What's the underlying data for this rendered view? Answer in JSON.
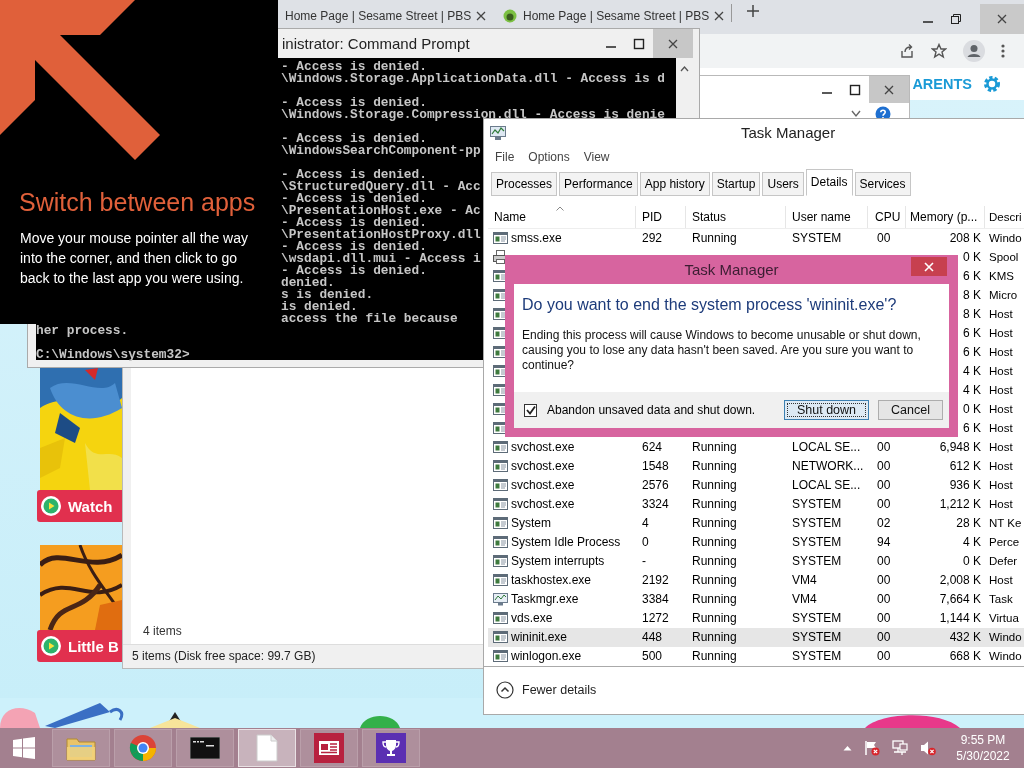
{
  "browser": {
    "tabs": [
      {
        "title": "Home Page | Sesame Street | PBS"
      },
      {
        "title": "Home Page | Sesame Street | PBS"
      }
    ],
    "page": {
      "nav_label": "ARENTS",
      "cards": [
        {
          "button": "Watch"
        },
        {
          "button": "Little B"
        }
      ]
    }
  },
  "explorer": {
    "pane_status": "4 items",
    "status_bar": "5 items (Disk free space: 99.7 GB)"
  },
  "command_prompt": {
    "title": "inistrator: Command Prompt",
    "blocks": [
      [
        "- Access is denied.",
        "\\Windows.Storage.ApplicationData.dll - Access is d"
      ],
      [
        "- Access is denied.",
        "\\Windows.Storage.Compression.dll - Access is denie"
      ],
      [
        "- Access is denied.",
        "\\WindowsSearchComponent-pp"
      ],
      [
        "- Access is denied.",
        "\\StructuredQuery.dll - Acc",
        "- Access is denied.",
        "\\PresentationHost.exe - Ac",
        "- Access is denied.",
        "\\PresentationHostProxy.dll",
        "- Access is denied.",
        "\\wsdapi.dll.mui - Access i",
        "- Access is denied.",
        "denied.",
        "s is denied.",
        "is denied.",
        "access the file because"
      ]
    ],
    "prompt_blocks": [
      [
        "her process."
      ],
      [
        "C:\\Windows\\system32>"
      ]
    ]
  },
  "task_manager": {
    "title": "Task Manager",
    "menu": [
      "File",
      "Options",
      "View"
    ],
    "tabs": [
      {
        "label": "Processes",
        "selected": false
      },
      {
        "label": "Performance",
        "selected": false
      },
      {
        "label": "App history",
        "selected": false
      },
      {
        "label": "Startup",
        "selected": false
      },
      {
        "label": "Users",
        "selected": false
      },
      {
        "label": "Details",
        "selected": true
      },
      {
        "label": "Services",
        "selected": false
      }
    ],
    "columns": [
      "Name",
      "PID",
      "Status",
      "User name",
      "CPU",
      "Memory (p...",
      "Descri"
    ],
    "rows": [
      {
        "kind": "program",
        "name": "smss.exe",
        "pid": "292",
        "status": "Running",
        "user": "SYSTEM",
        "cpu": "00",
        "memory": "208 K",
        "description": "Windo",
        "selected": false
      },
      {
        "kind": "printer",
        "memory": "0 K",
        "description": "Spool",
        "selected": false
      },
      {
        "kind": "program",
        "memory": "6 K",
        "description": "KMS",
        "selected": false
      },
      {
        "kind": "program",
        "memory": "8 K",
        "description": "Micro",
        "selected": false
      },
      {
        "kind": "program",
        "memory": "8 K",
        "description": "Host",
        "selected": false
      },
      {
        "kind": "program",
        "memory": "6 K",
        "description": "Host",
        "selected": false
      },
      {
        "kind": "program",
        "memory": "6 K",
        "description": "Host",
        "selected": false
      },
      {
        "kind": "program",
        "memory": "4 K",
        "description": "Host",
        "selected": false
      },
      {
        "kind": "program",
        "memory": "4 K",
        "description": "Host",
        "selected": false
      },
      {
        "kind": "program",
        "memory": "0 K",
        "description": "Host",
        "selected": false
      },
      {
        "kind": "program",
        "memory": "6 K",
        "description": "Host",
        "selected": false
      },
      {
        "kind": "program",
        "name": "svchost.exe",
        "pid": "624",
        "status": "Running",
        "user": "LOCAL SE...",
        "cpu": "00",
        "memory": "6,948 K",
        "description": "Host",
        "selected": false
      },
      {
        "kind": "program",
        "name": "svchost.exe",
        "pid": "1548",
        "status": "Running",
        "user": "NETWORK...",
        "cpu": "00",
        "memory": "612 K",
        "description": "Host",
        "selected": false
      },
      {
        "kind": "program",
        "name": "svchost.exe",
        "pid": "2576",
        "status": "Running",
        "user": "LOCAL SE...",
        "cpu": "00",
        "memory": "936 K",
        "description": "Host",
        "selected": false
      },
      {
        "kind": "program",
        "name": "svchost.exe",
        "pid": "3324",
        "status": "Running",
        "user": "SYSTEM",
        "cpu": "00",
        "memory": "1,212 K",
        "description": "Host",
        "selected": false
      },
      {
        "kind": "program",
        "name": "System",
        "pid": "4",
        "status": "Running",
        "user": "SYSTEM",
        "cpu": "02",
        "memory": "28 K",
        "description": "NT Ke",
        "selected": false
      },
      {
        "kind": "program",
        "name": "System Idle Process",
        "pid": "0",
        "status": "Running",
        "user": "SYSTEM",
        "cpu": "94",
        "memory": "4 K",
        "description": "Perce",
        "selected": false
      },
      {
        "kind": "program",
        "name": "System interrupts",
        "pid": "-",
        "status": "Running",
        "user": "SYSTEM",
        "cpu": "00",
        "memory": "0 K",
        "description": "Defer",
        "selected": false
      },
      {
        "kind": "program",
        "name": "taskhostex.exe",
        "pid": "2192",
        "status": "Running",
        "user": "VM4",
        "cpu": "00",
        "memory": "2,008 K",
        "description": "Host",
        "selected": false
      },
      {
        "kind": "chart",
        "name": "Taskmgr.exe",
        "pid": "3384",
        "status": "Running",
        "user": "VM4",
        "cpu": "00",
        "memory": "7,664 K",
        "description": "Task",
        "selected": false
      },
      {
        "kind": "program",
        "name": "vds.exe",
        "pid": "1272",
        "status": "Running",
        "user": "SYSTEM",
        "cpu": "00",
        "memory": "1,144 K",
        "description": "Virtua",
        "selected": false
      },
      {
        "kind": "program",
        "name": "wininit.exe",
        "pid": "448",
        "status": "Running",
        "user": "SYSTEM",
        "cpu": "00",
        "memory": "432 K",
        "description": "Windo",
        "selected": true
      },
      {
        "kind": "program",
        "name": "winlogon.exe",
        "pid": "500",
        "status": "Running",
        "user": "SYSTEM",
        "cpu": "00",
        "memory": "668 K",
        "description": "Windo",
        "selected": false
      }
    ],
    "footer": "Fewer details"
  },
  "dialog": {
    "title": "Task Manager",
    "heading": "Do you want to end the system process 'wininit.exe'?",
    "message": "Ending this process will cause Windows to become unusable or shut down, causing you to lose any data hasn't been saved. Are you sure you want to continue?",
    "checkbox": {
      "label": "Abandon unsaved data and shut down.",
      "checked": true
    },
    "buttons": [
      {
        "label": "Shut down",
        "focused": true
      },
      {
        "label": "Cancel",
        "focused": false
      }
    ]
  },
  "hint_overlay": {
    "title": "Switch between apps",
    "text": "Move your mouse pointer all the way into the corner, and then click to go back to the last app you were using."
  },
  "taskbar": {
    "items": [
      {
        "kind": "start",
        "active": false
      },
      {
        "kind": "folder",
        "active": false
      },
      {
        "kind": "chrome",
        "active": false
      },
      {
        "kind": "terminal",
        "active": false
      },
      {
        "kind": "document",
        "active": true
      },
      {
        "kind": "news",
        "active": false
      },
      {
        "kind": "trophy",
        "active": false
      }
    ],
    "tray": [
      {
        "kind": "caret"
      },
      {
        "kind": "flag"
      },
      {
        "kind": "network"
      },
      {
        "kind": "speaker"
      }
    ],
    "time": "9:55 PM",
    "date": "5/30/2022"
  }
}
